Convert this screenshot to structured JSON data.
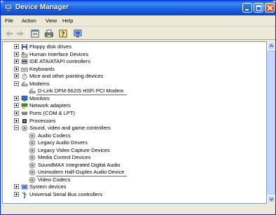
{
  "window": {
    "title": "Device Manager"
  },
  "menu": [
    {
      "label": "File"
    },
    {
      "label": "Action"
    },
    {
      "label": "View"
    },
    {
      "label": "Help"
    }
  ],
  "toolbar": {
    "buttons": [
      "back-icon",
      "forward-icon",
      "properties-icon",
      "print-icon",
      "help-icon",
      "scan-icon"
    ]
  },
  "tree": {
    "items": [
      {
        "label": "Floppy disk drives",
        "level": 1,
        "expander": "plus",
        "icon": "floppy-icon"
      },
      {
        "label": "Human Interface Devices",
        "level": 1,
        "expander": "plus",
        "icon": "hid-icon"
      },
      {
        "label": "IDE ATA/ATAPI controllers",
        "level": 1,
        "expander": "plus",
        "icon": "ide-icon"
      },
      {
        "label": "Keyboards",
        "level": 1,
        "expander": "plus",
        "icon": "keyboard-icon"
      },
      {
        "label": "Mice and other pointing devices",
        "level": 1,
        "expander": "plus",
        "icon": "mouse-icon"
      },
      {
        "label": "Modems",
        "level": 1,
        "expander": "minus",
        "icon": "modem-icon"
      },
      {
        "label": "D-Link DFM-562IS HSFi PCI Modem",
        "level": 2,
        "expander": "none",
        "icon": "modem-icon",
        "highlight": true
      },
      {
        "label": "Monitors",
        "level": 1,
        "expander": "plus",
        "icon": "monitor-icon"
      },
      {
        "label": "Network adapters",
        "level": 1,
        "expander": "plus",
        "icon": "network-icon"
      },
      {
        "label": "Ports (COM & LPT)",
        "level": 1,
        "expander": "plus",
        "icon": "port-icon"
      },
      {
        "label": "Processors",
        "level": 1,
        "expander": "plus",
        "icon": "processor-icon"
      },
      {
        "label": "Sound, video and game controllers",
        "level": 1,
        "expander": "minus",
        "icon": "sound-icon"
      },
      {
        "label": "Audio Codecs",
        "level": 2,
        "expander": "none",
        "icon": "sound-icon"
      },
      {
        "label": "Legacy Audio Drivers",
        "level": 2,
        "expander": "none",
        "icon": "sound-icon"
      },
      {
        "label": "Legacy Video Capture Devices",
        "level": 2,
        "expander": "none",
        "icon": "sound-icon"
      },
      {
        "label": "Media Control Devices",
        "level": 2,
        "expander": "none",
        "icon": "sound-icon"
      },
      {
        "label": "SoundMAX Integrated Digital Audio",
        "level": 2,
        "expander": "none",
        "icon": "sound-icon"
      },
      {
        "label": "Unimodem Half-Duplex Audio Device",
        "level": 2,
        "expander": "none",
        "icon": "sound-icon",
        "highlight": true
      },
      {
        "label": "Video Codecs",
        "level": 2,
        "expander": "none",
        "icon": "sound-icon"
      },
      {
        "label": "System devices",
        "level": 1,
        "expander": "plus",
        "icon": "system-icon"
      },
      {
        "label": "Universal Serial Bus controllers",
        "level": 1,
        "expander": "plus",
        "icon": "usb-icon"
      }
    ]
  },
  "colors": {
    "highlight_underline": "#e53a17",
    "titlebar": "#0b47c6"
  }
}
